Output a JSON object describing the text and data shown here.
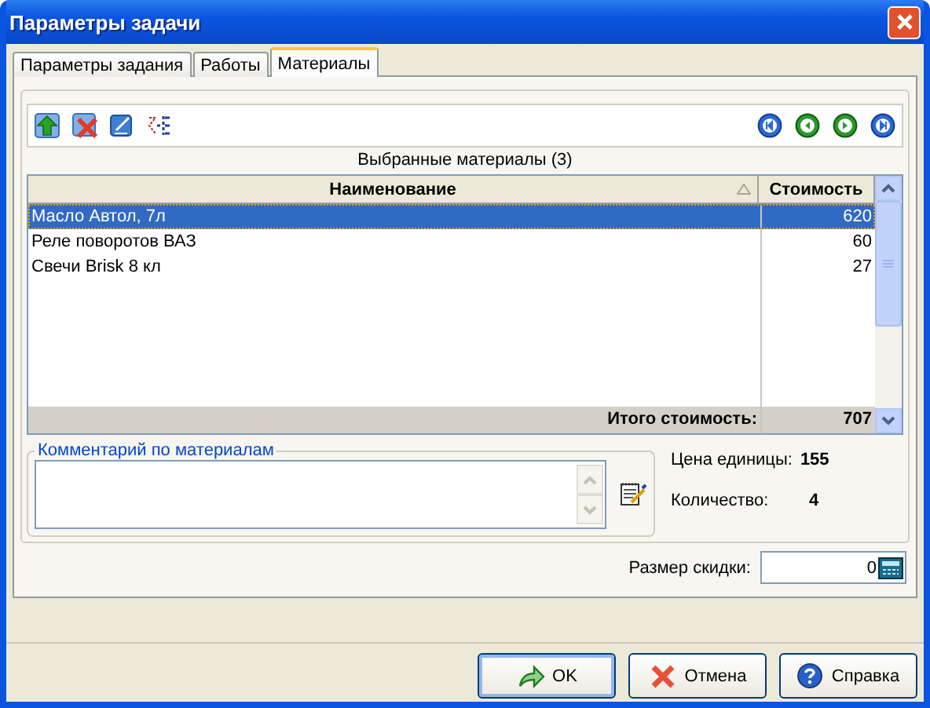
{
  "window": {
    "title": "Параметры задачи"
  },
  "tabs": [
    {
      "label": "Параметры задания",
      "selected": false
    },
    {
      "label": "Работы",
      "selected": false
    },
    {
      "label": "Материалы",
      "selected": true
    }
  ],
  "grid": {
    "caption": "Выбранные материалы (3)",
    "columns": [
      "Наименование",
      "Стоимость"
    ],
    "rows": [
      {
        "name": "Масло Автол, 7л",
        "cost": "620",
        "selected": true
      },
      {
        "name": "Реле поворотов ВАЗ",
        "cost": "60",
        "selected": false
      },
      {
        "name": "Свечи Brisk 8 кл",
        "cost": "27",
        "selected": false
      }
    ],
    "total_label": "Итого стоимость:",
    "total": "707"
  },
  "comment": {
    "legend": "Комментарий по материалам"
  },
  "unit_price": {
    "label": "Цена единицы:",
    "value": "155"
  },
  "quantity": {
    "label": "Количество:",
    "value": "4"
  },
  "discount": {
    "label": "Размер скидки:",
    "value": "0"
  },
  "buttons": [
    {
      "label": "OK",
      "kind": "ok"
    },
    {
      "label": "Отмена",
      "kind": "cancel"
    },
    {
      "label": "Справка",
      "kind": "help"
    }
  ]
}
